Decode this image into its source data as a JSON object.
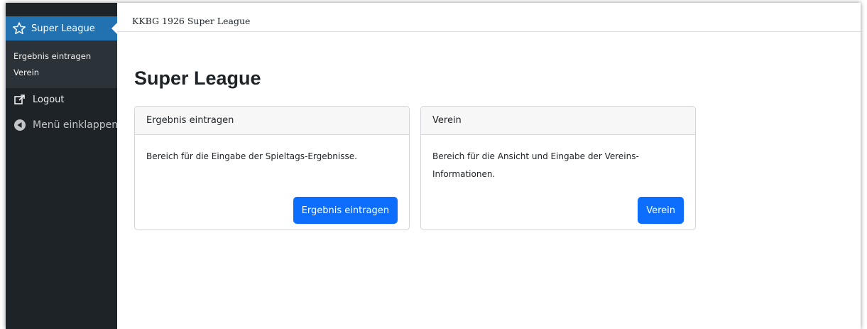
{
  "sidebar": {
    "active_menu": {
      "label": "Super League",
      "icon": "star-icon"
    },
    "submenu": [
      {
        "label": "Ergebnis eintragen"
      },
      {
        "label": "Verein"
      }
    ],
    "logout": {
      "label": "Logout",
      "icon": "external-link-icon"
    },
    "collapse": {
      "label": "Menü einklappen",
      "icon": "collapse-arrow-icon"
    }
  },
  "topbar": {
    "title": "KKBG 1926 Super League"
  },
  "page": {
    "title": "Super League"
  },
  "cards": [
    {
      "header": "Ergebnis eintragen",
      "text": "Bereich für die Eingabe der Spieltags-Ergebnisse.",
      "button": "Ergebnis eintragen"
    },
    {
      "header": "Verein",
      "text": "Bereich für die Ansicht und Eingabe der Vereins-Informationen.",
      "button": "Verein"
    }
  ],
  "colors": {
    "sidebar_bg": "#1d2327",
    "submenu_bg": "#2c3338",
    "active_menu_bg": "#2271b1",
    "button_primary": "#0d6efd"
  }
}
